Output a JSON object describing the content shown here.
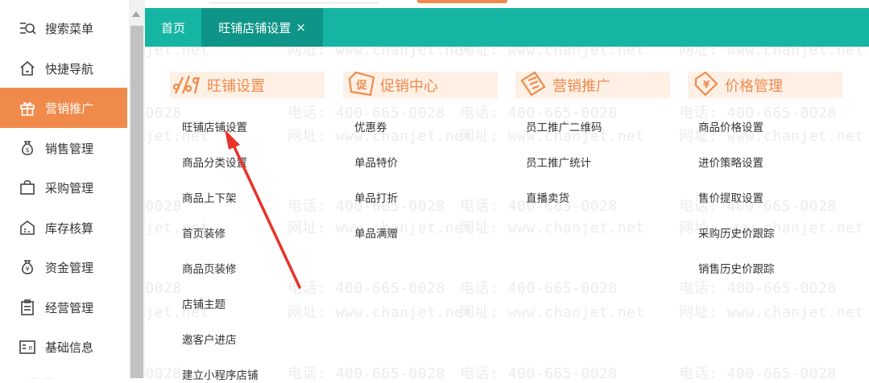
{
  "sidebar": {
    "items": [
      {
        "label": "搜索菜单",
        "icon": "search-menu-icon"
      },
      {
        "label": "快捷导航",
        "icon": "home-icon"
      },
      {
        "label": "营销推广",
        "icon": "gift-icon"
      },
      {
        "label": "销售管理",
        "icon": "money-bag-icon"
      },
      {
        "label": "采购管理",
        "icon": "shopping-bag-icon"
      },
      {
        "label": "库存核算",
        "icon": "warehouse-icon"
      },
      {
        "label": "资金管理",
        "icon": "yen-bag-icon"
      },
      {
        "label": "经营管理",
        "icon": "clipboard-icon"
      },
      {
        "label": "基础信息",
        "icon": "id-card-icon"
      }
    ],
    "active_index": 2
  },
  "tabs": {
    "home_label": "首页",
    "active_label": "旺铺店铺设置",
    "close_glyph": "×"
  },
  "groups": [
    {
      "title": "旺铺设置",
      "icon": "shop-settings-icon",
      "links": [
        "旺铺店铺设置",
        "商品分类设置",
        "商品上下架",
        "首页装修",
        "商品页装修",
        "店铺主题",
        "邀客户进店",
        "建立小程序店铺"
      ]
    },
    {
      "title": "促销中心",
      "icon": "promotion-tag-icon",
      "links": [
        "优惠券",
        "单品特价",
        "单品打折",
        "单品满赠"
      ]
    },
    {
      "title": "营销推广",
      "icon": "marketing-ticket-icon",
      "links": [
        "员工推广二维码",
        "员工推广统计",
        "直播卖货"
      ]
    },
    {
      "title": "价格管理",
      "icon": "price-tag-icon",
      "links": [
        "商品价格设置",
        "进价策略设置",
        "售价提取设置",
        "采购历史价跟踪",
        "销售历史价跟踪"
      ]
    }
  ],
  "watermark": {
    "phone": "电话: 400-665-0028",
    "site": "网址: www.chanjet.net"
  },
  "colors": {
    "accent_orange": "#f08a4b",
    "tab_teal": "#16b5a3",
    "tab_active_teal": "#0e9587",
    "header_bg": "#fef0e5",
    "annotation_arrow": "#e8322a"
  }
}
